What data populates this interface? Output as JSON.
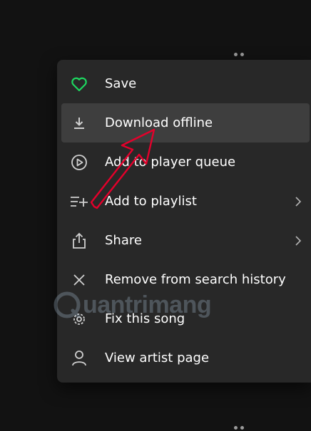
{
  "menu": {
    "items": [
      {
        "label": "Save",
        "icon": "heart-icon",
        "submenu": false
      },
      {
        "label": "Download offline",
        "icon": "download-icon",
        "submenu": false
      },
      {
        "label": "Add to player queue",
        "icon": "play-circle-icon",
        "submenu": false
      },
      {
        "label": "Add to playlist",
        "icon": "playlist-add-icon",
        "submenu": true
      },
      {
        "label": "Share",
        "icon": "share-icon",
        "submenu": true
      },
      {
        "label": "Remove from search history",
        "icon": "close-icon",
        "submenu": false
      },
      {
        "label": "Fix this song",
        "icon": "gear-icon",
        "submenu": false
      },
      {
        "label": "View artist page",
        "icon": "person-icon",
        "submenu": false
      }
    ]
  },
  "watermark": {
    "text": "uantrimang"
  },
  "colors": {
    "accent_green": "#1ed760",
    "annotation_red": "#e4002b",
    "menu_bg": "#282828",
    "hover_bg": "#3e3e3e"
  }
}
